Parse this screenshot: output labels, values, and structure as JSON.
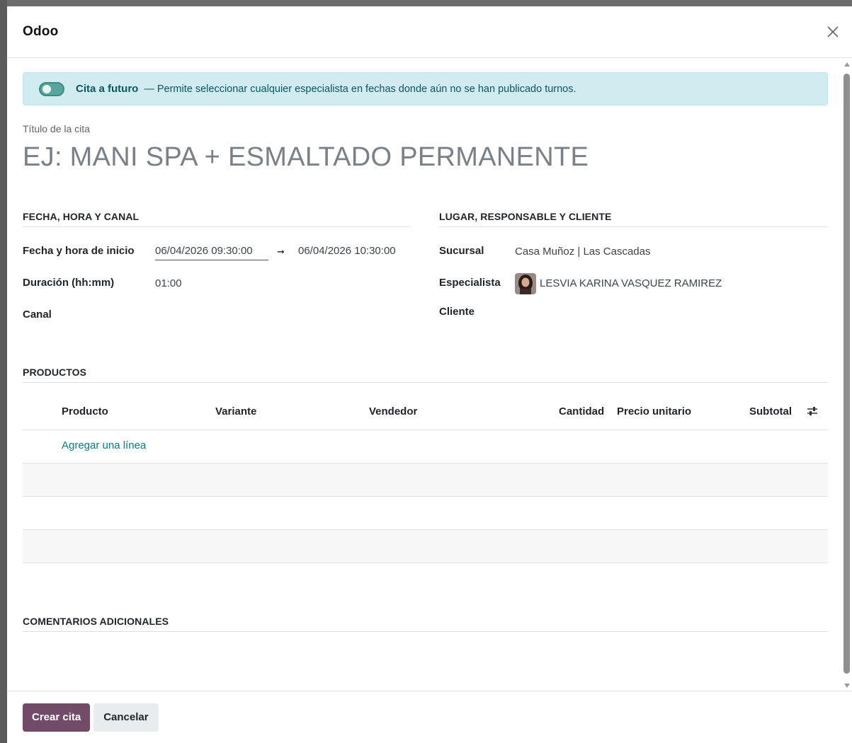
{
  "dialog": {
    "title": "Odoo"
  },
  "alert": {
    "toggle_label": "Cita a futuro",
    "description": "— Permite seleccionar cualquier especialista en fechas donde aún no se han publicado turnos.",
    "toggle_on": true
  },
  "title_field": {
    "label": "Título de la cita",
    "placeholder": "EJ: MANI SPA + ESMALTADO PERMANENTE"
  },
  "sections": {
    "fecha": "FECHA, HORA Y CANAL",
    "lugar": "LUGAR, RESPONSABLE Y CLIENTE",
    "productos": "PRODUCTOS",
    "comentarios": "COMENTARIOS ADICIONALES"
  },
  "fields": {
    "start_label": "Fecha y hora de inicio",
    "start_value": "06/04/2026 09:30:00",
    "end_value": "06/04/2026 10:30:00",
    "duration_label": "Duración (hh:mm)",
    "duration_value": "01:00",
    "channel_label": "Canal",
    "branch_label": "Sucursal",
    "branch_value": "Casa Muñoz | Las Cascadas",
    "specialist_label": "Especialista",
    "specialist_value": "LESVIA KARINA VASQUEZ RAMIREZ",
    "client_label": "Cliente"
  },
  "products_table": {
    "columns": [
      "Producto",
      "Variante",
      "Vendedor",
      "Cantidad",
      "Precio unitario",
      "Subtotal"
    ],
    "add_line": "Agregar una línea"
  },
  "footer": {
    "create_label": "Crear cita",
    "cancel_label": "Cancelar"
  },
  "colors": {
    "primary": "#714b67",
    "link": "#017e84",
    "alert_bg": "#d1ecf1"
  }
}
